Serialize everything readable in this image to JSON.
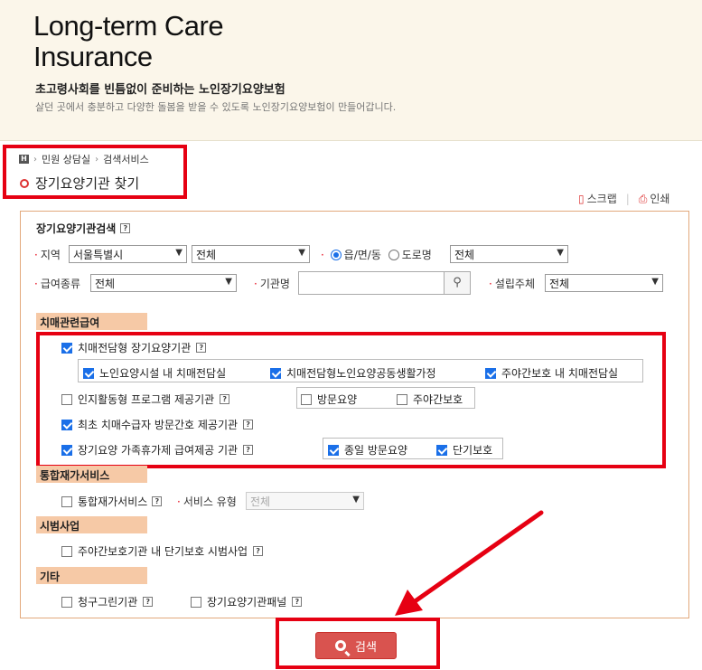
{
  "banner": {
    "title_line1": "Long-term Care",
    "title_line2": "Insurance",
    "subtitle": "초고령사회를 빈틈없이 준비하는 노인장기요양보험",
    "description": "살던 곳에서 충분하고 다양한 돌봄을 받을 수 있도록 노인장기요양보험이 만들어갑니다."
  },
  "breadcrumb": {
    "home_label": "H",
    "items": [
      "민원 상담실",
      "검색서비스"
    ]
  },
  "page_title": "장기요양기관 찾기",
  "tools": {
    "scrap": "스크랩",
    "print": "인쇄"
  },
  "form": {
    "title": "장기요양기관검색",
    "region_label": "지역",
    "region_city": "서울특별시",
    "region_district": "전체",
    "radio_eup": "읍/면/동",
    "radio_road": "도로명",
    "region_dong": "전체",
    "benefit_type_label": "급여종류",
    "benefit_type_value": "전체",
    "org_name_label": "기관명",
    "org_name_value": "",
    "founder_label": "설립주체",
    "founder_value": "전체"
  },
  "sections": {
    "dementia": {
      "title": "치매관련급여",
      "item1": "치매전담형 장기요양기관",
      "sub1": "노인요양시설 내 치매전담실",
      "sub2": "치매전담형노인요양공동생활가정",
      "sub3": "주야간보호 내 치매전담실",
      "item2": "인지활동형 프로그램 제공기관",
      "sub4": "방문요양",
      "sub5": "주야간보호",
      "item3": "최초 치매수급자 방문간호 제공기관",
      "item4": "장기요양 가족휴가제 급여제공 기관",
      "sub6": "종일 방문요양",
      "sub7": "단기보호"
    },
    "integrated": {
      "title": "통합재가서비스",
      "item": "통합재가서비스",
      "service_type_label": "서비스 유형",
      "service_type_value": "전체"
    },
    "pilot": {
      "title": "시범사업",
      "item": "주야간보호기관 내 단기보호 시범사업"
    },
    "etc": {
      "title": "기타",
      "item1": "청구그린기관",
      "item2": "장기요양기관패널"
    }
  },
  "search_button": "검색",
  "colors": {
    "highlight": "#e60012",
    "button": "#d9534f",
    "section": "#f6c9a6",
    "panel_border": "#e2a97c"
  }
}
